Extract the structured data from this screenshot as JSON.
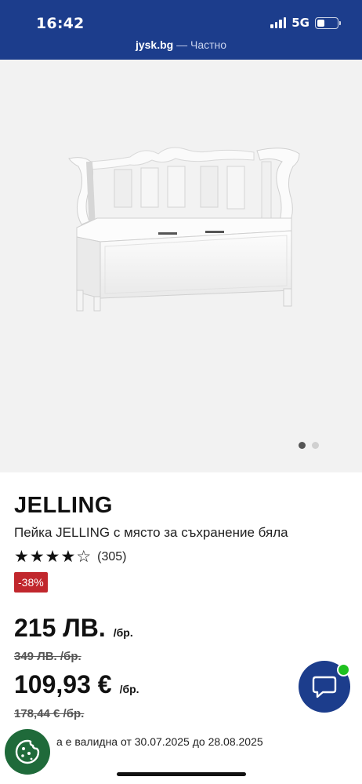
{
  "status_bar": {
    "time": "16:42",
    "network": "5G",
    "icons": [
      "signal-icon",
      "battery-icon"
    ]
  },
  "browser": {
    "domain": "jysk.bg",
    "mode": " — Частно"
  },
  "gallery": {
    "image_alt": "product-bench-image",
    "page_count": 2,
    "active_page": 1
  },
  "product": {
    "brand": "JELLING",
    "description": "Пейка JELLING с място за съхранение бяла",
    "rating": 4.5,
    "rating_count": "(305)",
    "discount_badge": "-38%",
    "price_bgn": "215 ЛВ.",
    "price_unit": "/бр.",
    "old_price_bgn": "349 ЛВ. /бр.",
    "price_eur": "109,93 €",
    "price_eur_unit": "/бр.",
    "old_price_eur": "178,44 € /бр.",
    "promo_text": "а е валидна от 30.07.2025 до 28.08.2025"
  },
  "colors": {
    "brand_blue": "#1c3d8c",
    "discount_red": "#c1272d",
    "online_green": "#1fc11f",
    "cookie_green": "#1f6a3a"
  },
  "icons": {
    "chat": "chat-bubble-icon",
    "cookie": "cookie-icon",
    "star": "star-icon"
  }
}
